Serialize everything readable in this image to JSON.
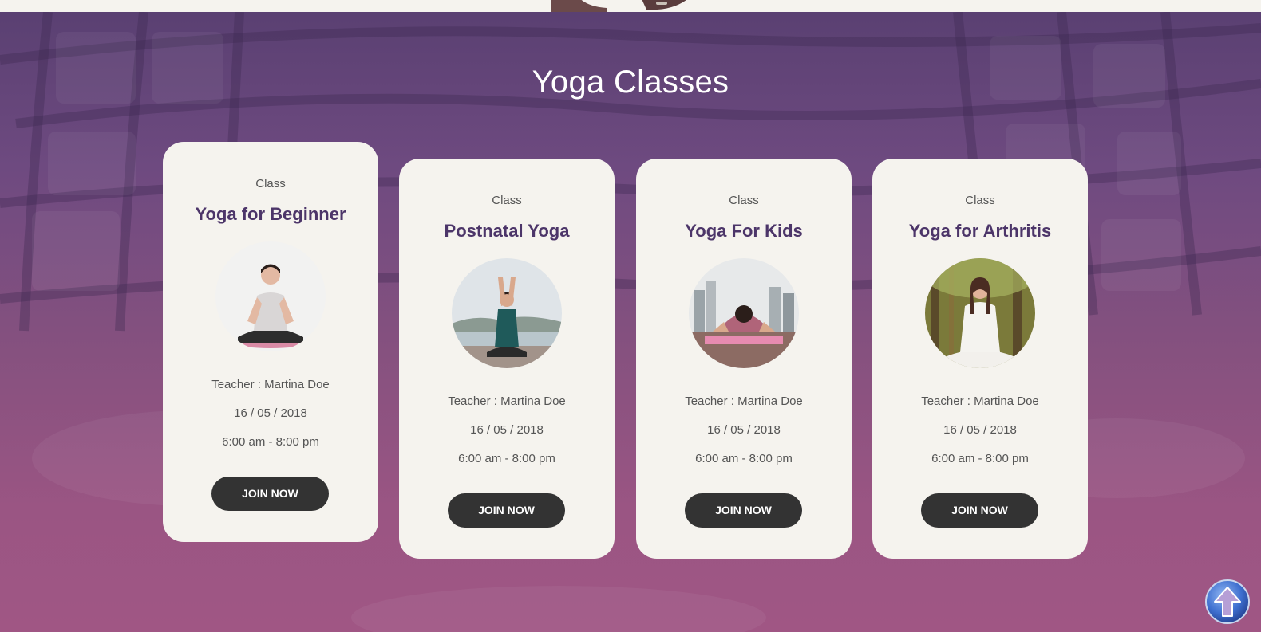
{
  "section": {
    "title": "Yoga Classes"
  },
  "classes": [
    {
      "label": "Class",
      "name": "Yoga for Beginner",
      "teacher": "Teacher : Martina Doe",
      "date": "16 / 05 / 2018",
      "time": "6:00 am - 8:00 pm",
      "button": "JOIN NOW",
      "photo": "woman-meditating-white-background"
    },
    {
      "label": "Class",
      "name": "Postnatal Yoga",
      "teacher": "Teacher : Martina Doe",
      "date": "16 / 05 / 2018",
      "time": "6:00 am - 8:00 pm",
      "button": "JOIN NOW",
      "photo": "woman-arms-raised-by-harbor"
    },
    {
      "label": "Class",
      "name": "Yoga For Kids",
      "teacher": "Teacher : Martina Doe",
      "date": "16 / 05 / 2018",
      "time": "6:00 am - 8:00 pm",
      "button": "JOIN NOW",
      "photo": "woman-child-pose-city-rooftop"
    },
    {
      "label": "Class",
      "name": "Yoga for Arthritis",
      "teacher": "Teacher : Martina Doe",
      "date": "16 / 05 / 2018",
      "time": "6:00 am - 8:00 pm",
      "button": "JOIN NOW",
      "photo": "woman-meditating-forest"
    }
  ],
  "scroll_top": {
    "icon": "arrow-up-icon"
  },
  "colors": {
    "heading": "#4c3569",
    "button": "#333333",
    "card": "#f5f3ee"
  }
}
